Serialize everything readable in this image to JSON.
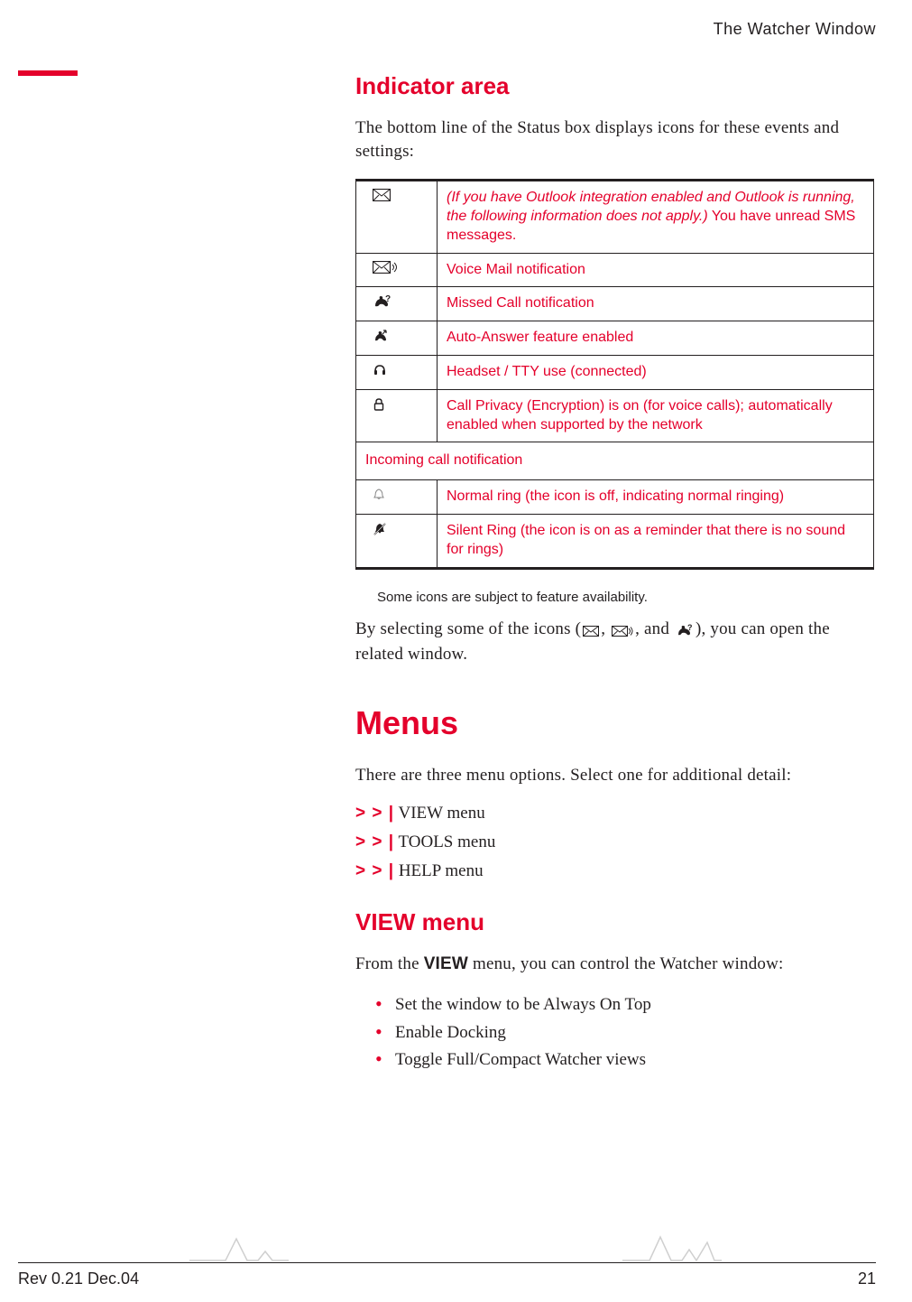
{
  "header": {
    "title": "The Watcher Window"
  },
  "section1": {
    "heading": "Indicator area",
    "intro": "The bottom line of the Status box displays icons for these events and settings:",
    "table": {
      "rows": [
        {
          "icon": "envelope-icon",
          "text_italic": "(If you have Outlook integration enabled and Outlook is running, the following information does not apply.)",
          "text_plain": "You have unread SMS messages."
        },
        {
          "icon": "envelope-sound-icon",
          "text": "Voice Mail notification"
        },
        {
          "icon": "missed-call-icon",
          "text": "Missed Call notification"
        },
        {
          "icon": "auto-answer-icon",
          "text": "Auto-Answer feature enabled"
        },
        {
          "icon": "headset-icon",
          "text": "Headset / TTY use (connected)"
        },
        {
          "icon": "lock-icon",
          "text": "Call Privacy (Encryption) is on (for voice calls); automatically enabled when supported by the network"
        }
      ],
      "subheader": "Incoming call notification",
      "rows2": [
        {
          "icon": "bell-icon",
          "text": "Normal ring (the icon is off, indicating normal ringing)"
        },
        {
          "icon": "bell-mute-icon",
          "text": "Silent Ring (the icon is on as a reminder that there is no sound for rings)"
        }
      ]
    },
    "note": "Some icons are subject to feature availability.",
    "after_note_pre": "By selecting some of the icons (",
    "after_note_mid1": ", ",
    "after_note_mid2": ", and ",
    "after_note_post": "), you can open the related window."
  },
  "section2": {
    "heading": "Menus",
    "intro": "There are three menu options. Select one for additional detail:",
    "links": [
      {
        "prefix": "> > |",
        "label": "VIEW menu"
      },
      {
        "prefix": "> > |",
        "label": "TOOLS menu"
      },
      {
        "prefix": "> > |",
        "label": "HELP menu"
      }
    ]
  },
  "section3": {
    "heading": "VIEW menu",
    "intro_pre": "From the ",
    "intro_bold": "VIEW",
    "intro_post": " menu, you can control the Watcher window:",
    "bullets": [
      "Set the window to be Always On Top",
      "Enable Docking",
      "Toggle Full/Compact Watcher views"
    ]
  },
  "footer": {
    "rev": "Rev 0.21  Dec.04",
    "page": "21"
  }
}
